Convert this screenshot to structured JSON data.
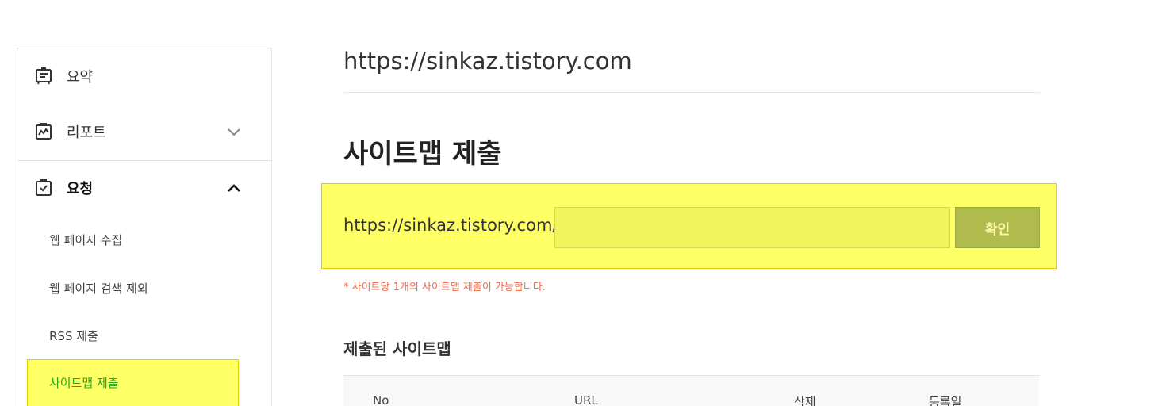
{
  "sidebar": {
    "items": [
      {
        "label": "요약",
        "icon": "summary-board-icon"
      },
      {
        "label": "리포트",
        "icon": "report-chart-icon"
      },
      {
        "label": "요청",
        "icon": "clipboard-check-icon"
      }
    ],
    "sub_items": [
      {
        "label": "웹 페이지 수집"
      },
      {
        "label": "웹 페이지 검색 제외"
      },
      {
        "label": "RSS 제출"
      },
      {
        "label": "사이트맵 제출"
      }
    ]
  },
  "main": {
    "site_url": "https://sinkaz.tistory.com",
    "section_title": "사이트맵 제출",
    "form": {
      "prefix": "https://sinkaz.tistory.com/",
      "input_value": "",
      "submit_label": "확인"
    },
    "note": "* 사이트당 1개의 사이트맵 제출이 가능합니다.",
    "submitted_title": "제출된 사이트맵",
    "table": {
      "headers": [
        "No",
        "URL",
        "삭제",
        "등록일"
      ]
    }
  },
  "colors": {
    "highlight": "#ffff66",
    "active_text": "#2aa51a",
    "note_text": "#f06a4a",
    "button_bg": "#b0bc4e"
  }
}
